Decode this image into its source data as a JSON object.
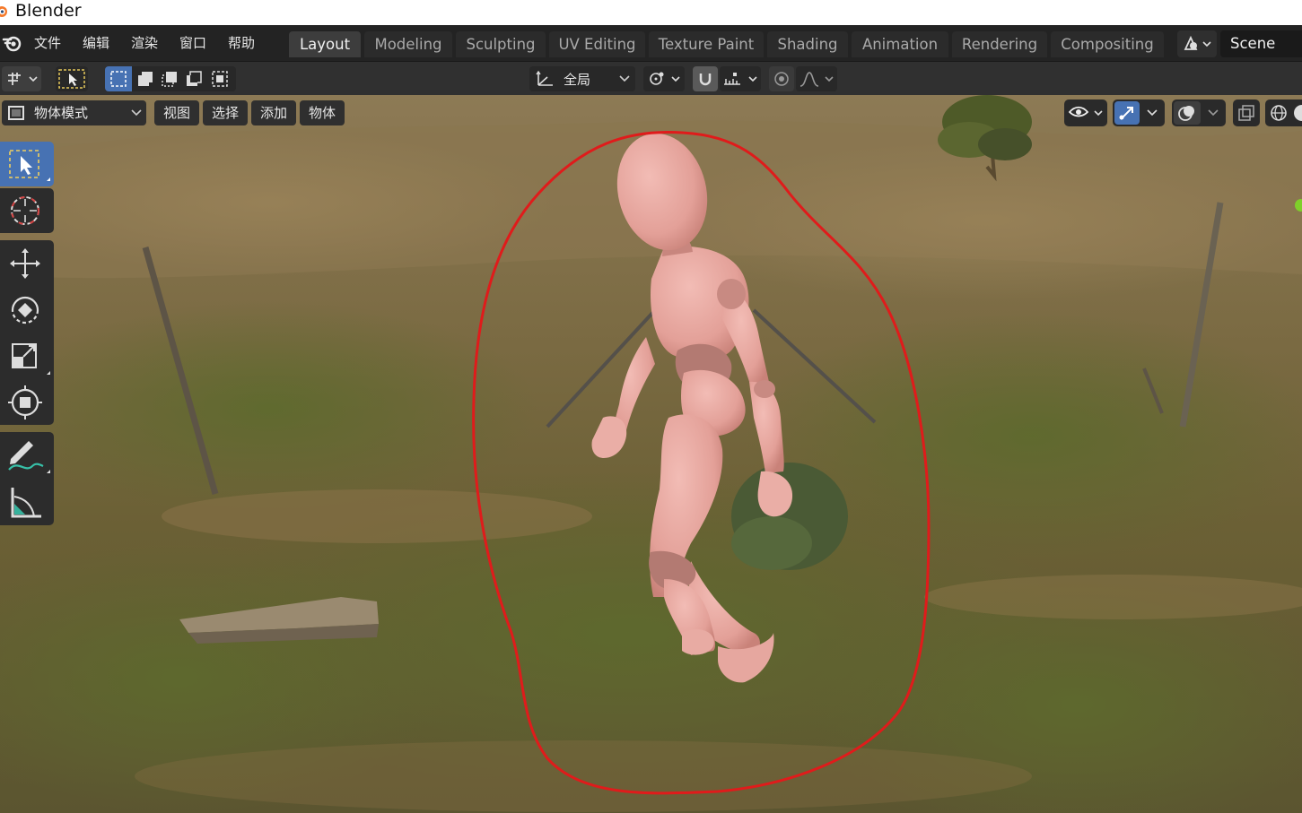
{
  "os_window": {
    "title": "Blender"
  },
  "topbar": {
    "menus": [
      "文件",
      "编辑",
      "渲染",
      "窗口",
      "帮助"
    ],
    "workspace_tabs": [
      "Layout",
      "Modeling",
      "Sculpting",
      "UV Editing",
      "Texture Paint",
      "Shading",
      "Animation",
      "Rendering",
      "Compositing"
    ],
    "active_tab": "Layout",
    "scene_name": "Scene"
  },
  "tool_header": {
    "transform_orientation": "全局"
  },
  "viewport_header": {
    "mode": "物体模式",
    "menus": [
      "视图",
      "选择",
      "添加",
      "物体"
    ]
  },
  "toolbar": {
    "tools": [
      "select-box",
      "cursor",
      "move",
      "rotate",
      "scale",
      "transform",
      "annotate",
      "measure"
    ],
    "active": "select-box"
  },
  "colors": {
    "accent": "#4772b3",
    "annotation": "#e01b1b",
    "figure": "#e8a6a0"
  }
}
